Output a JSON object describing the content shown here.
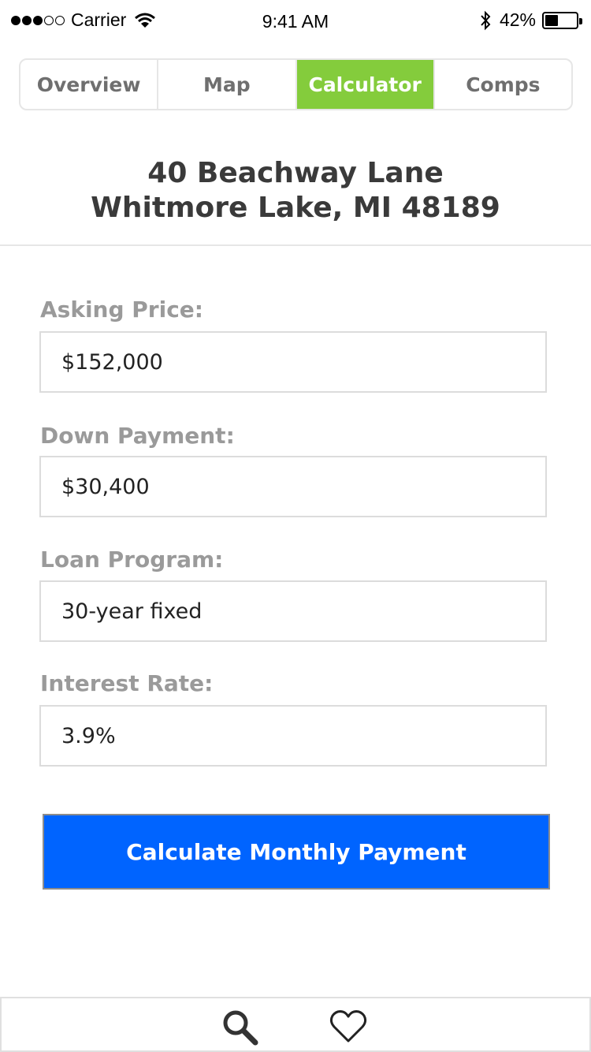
{
  "status_bar": {
    "carrier": "Carrier",
    "time": "9:41 AM",
    "battery": "42%",
    "battery_level": 0.42,
    "signal_bars": 3,
    "signal_total": 5
  },
  "tabs": [
    {
      "label": "Overview",
      "active": false
    },
    {
      "label": "Map",
      "active": false
    },
    {
      "label": "Calculator",
      "active": true
    },
    {
      "label": "Comps",
      "active": false
    }
  ],
  "address": {
    "line1": "40 Beachway Lane",
    "line2": "Whitmore Lake, MI 48189"
  },
  "form": {
    "asking_price": {
      "label": "Asking Price:",
      "value": "$152,000"
    },
    "down_payment": {
      "label": "Down Payment:",
      "value": "$30,400"
    },
    "loan_program": {
      "label": "Loan Program:",
      "value": "30-year fixed"
    },
    "interest_rate": {
      "label": "Interest Rate:",
      "value": "3.9%"
    }
  },
  "actions": {
    "calculate_label": "Calculate Monthly Payment"
  },
  "bottom_bar": {
    "icons": [
      "search-icon",
      "heart-icon"
    ]
  },
  "colors": {
    "accent_green": "#84cc3c",
    "button_blue": "#0064ff",
    "label_gray": "#9a9a9a"
  }
}
